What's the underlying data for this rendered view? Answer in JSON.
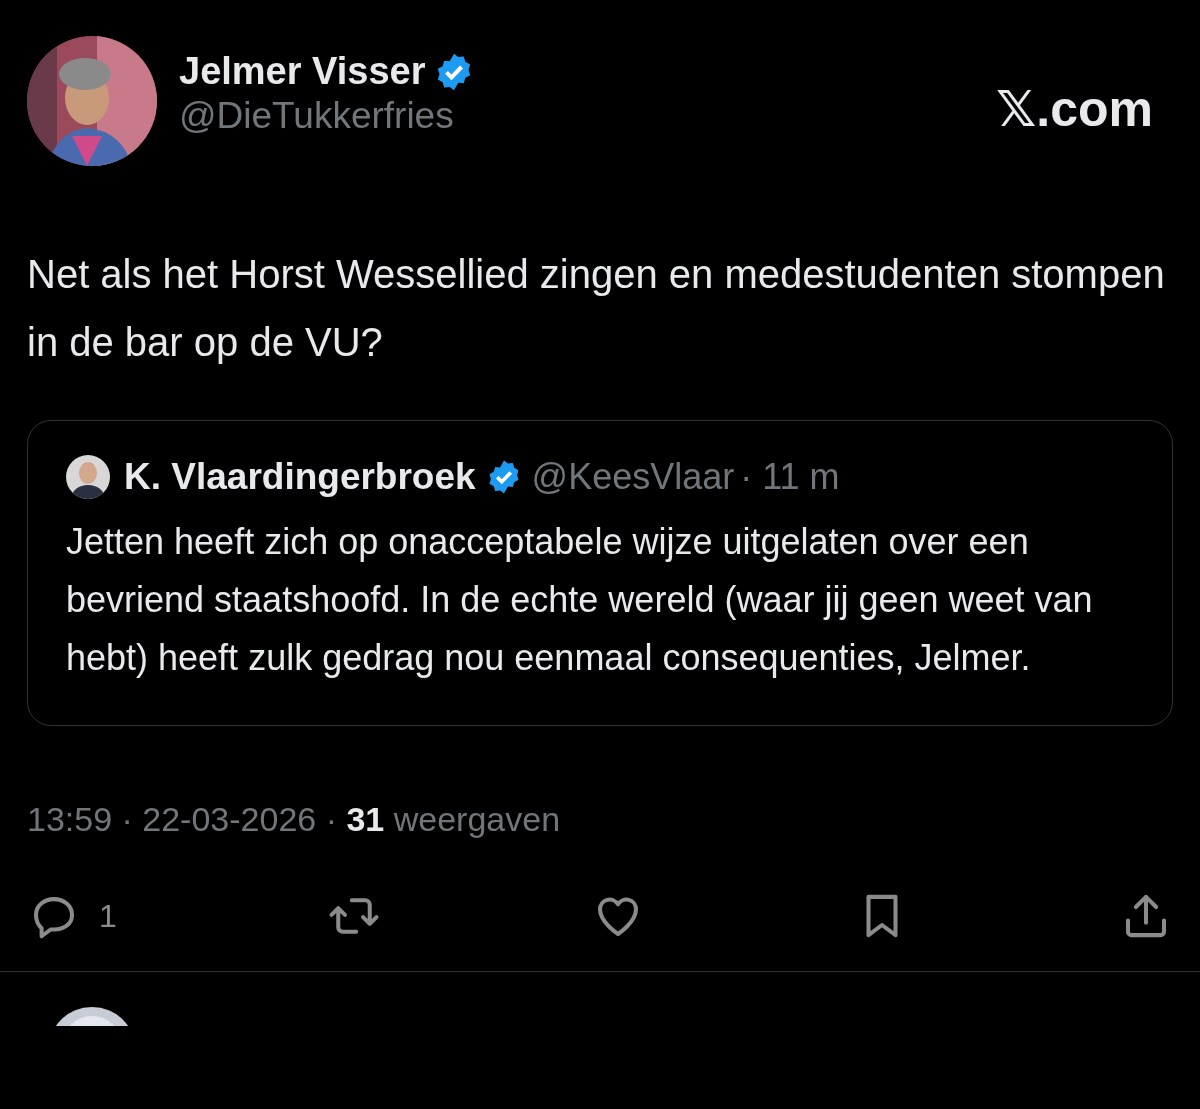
{
  "brand": "𝕏.com",
  "author": {
    "name": "Jelmer Visser",
    "handle": "@DieTukkerfries",
    "verified": true
  },
  "text": "Net als het Horst Wessellied zingen en medestudenten stompen in de bar op de VU?",
  "quote": {
    "name": "K. Vlaardingerbroek",
    "verified": true,
    "handle": "@KeesVlaar",
    "time": "· 11 m",
    "text": "Jetten heeft zich op onacceptabele wijze uitgelaten over een bevriend staatshoofd. In de echte wereld (waar jij geen weet van hebt) heeft zulk gedrag nou eenmaal consequenties, Jelmer."
  },
  "meta": "13:59 · 22-03-2026 · **31** weergaven",
  "actions": [
    {
      "kind": "reply",
      "count": "1"
    },
    {
      "kind": "repost"
    },
    {
      "kind": "like"
    },
    {
      "kind": "bookmark"
    },
    {
      "kind": "share"
    }
  ]
}
